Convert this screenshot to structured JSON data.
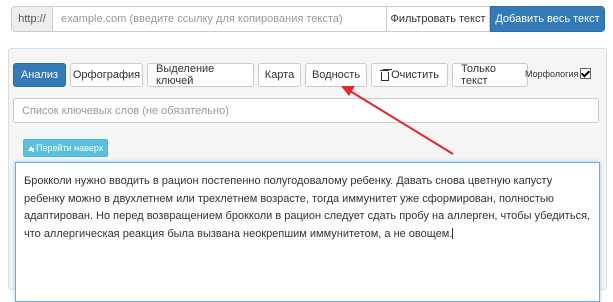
{
  "urlbar": {
    "prefix": "http://",
    "placeholder": "example.com (введите ссылку для копирования текста)",
    "filter_label": "Фильтровать текст",
    "add_label": "Добавить весь текст"
  },
  "toolbar": {
    "buttons": [
      {
        "label": "Анализ"
      },
      {
        "label": "Орфография"
      },
      {
        "label": "Выделение ключей"
      },
      {
        "label": "Карта"
      },
      {
        "label": "Водность"
      },
      {
        "label": "Очистить",
        "icon": "trash-icon"
      },
      {
        "label": "Только текст"
      }
    ],
    "morph_label": "Морфология",
    "morph_checked": true
  },
  "keywords": {
    "placeholder": "Список ключевых слов (не обязательно)"
  },
  "scroll_top_label": "Перейти наверх",
  "editor": {
    "text": "Брокколи нужно вводить в рацион постепенно полугодовалому ребенку. Давать снова цветную капусту ребенку можно в двухлетнем или трехлетнем возрасте, тогда иммунитет уже сформирован, полностью адаптирован. Но перед возвращением брокколи в рацион следует сдать пробу на аллерген, чтобы убедиться, что аллергическая реакция была вызвана неокрепшим иммунитетом, а не овощем."
  },
  "colors": {
    "primary": "#337ab7",
    "info": "#5bc0de",
    "annotation": "#e8272c"
  }
}
